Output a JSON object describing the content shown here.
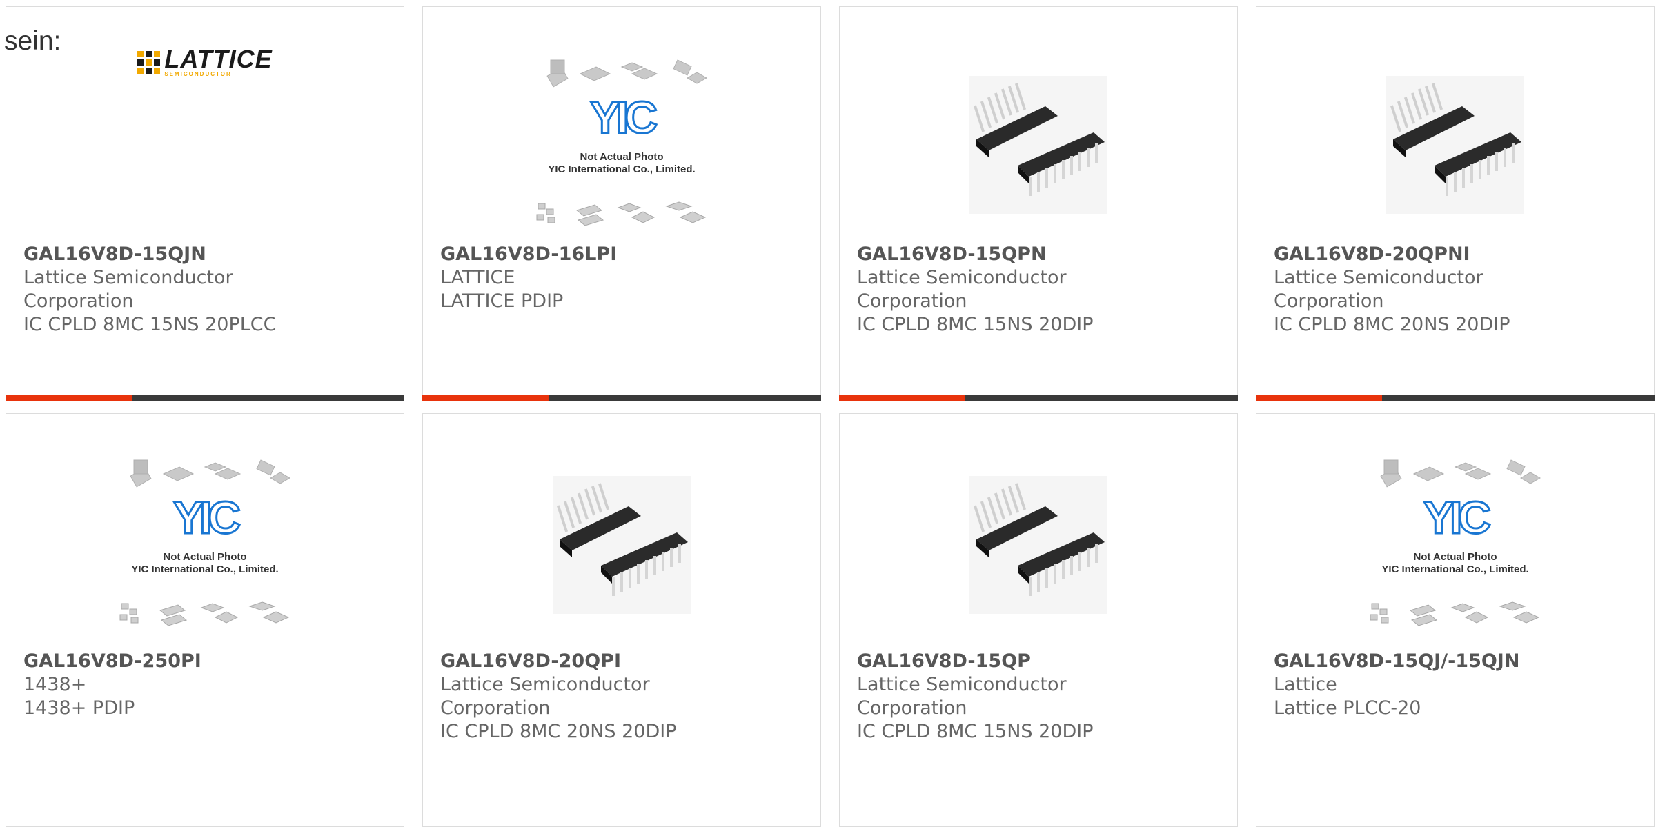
{
  "intro_text": "sein:",
  "icons": {
    "lattice": "lattice-logo-icon",
    "yic": "yic-placeholder-icon",
    "dip": "dip-chip-icon"
  },
  "colors": {
    "accent": "#e8330c",
    "bar": "#3a3a3a",
    "text": "#666666",
    "yic_blue": "#1976d2",
    "lattice_gold": "#f2a900"
  },
  "lattice_logo": {
    "word": "LATTICE",
    "sub": "SEMICONDUCTOR"
  },
  "yic_placeholder": {
    "logo": "YIC",
    "line1": "Not Actual Photo",
    "line2": "YIC International Co., Limited."
  },
  "products": [
    {
      "part": "GAL16V8D-15QJN",
      "mfr_line1": "Lattice Semiconductor",
      "mfr_line2": "Corporation",
      "desc": "IC CPLD 8MC 15NS 20PLCC",
      "image": "lattice-logo-icon"
    },
    {
      "part": "GAL16V8D-16LPI",
      "mfr_line1": "LATTICE",
      "mfr_line2": "",
      "desc": "LATTICE PDIP",
      "image": "yic-placeholder-icon"
    },
    {
      "part": "GAL16V8D-15QPN",
      "mfr_line1": "Lattice Semiconductor",
      "mfr_line2": "Corporation",
      "desc": "IC CPLD 8MC 15NS 20DIP",
      "image": "dip-chip-icon"
    },
    {
      "part": "GAL16V8D-20QPNI",
      "mfr_line1": "Lattice Semiconductor",
      "mfr_line2": "Corporation",
      "desc": "IC CPLD 8MC 20NS 20DIP",
      "image": "dip-chip-icon"
    },
    {
      "part": "GAL16V8D-250PI",
      "mfr_line1": "1438+",
      "mfr_line2": "",
      "desc": "1438+ PDIP",
      "image": "yic-placeholder-icon"
    },
    {
      "part": "GAL16V8D-20QPI",
      "mfr_line1": "Lattice Semiconductor",
      "mfr_line2": "Corporation",
      "desc": "IC CPLD 8MC 20NS 20DIP",
      "image": "dip-chip-icon"
    },
    {
      "part": "GAL16V8D-15QP",
      "mfr_line1": "Lattice Semiconductor",
      "mfr_line2": "Corporation",
      "desc": "IC CPLD 8MC 15NS 20DIP",
      "image": "dip-chip-icon"
    },
    {
      "part": "GAL16V8D-15QJ/-15QJN",
      "mfr_line1": "Lattice",
      "mfr_line2": "",
      "desc": "Lattice PLCC-20",
      "image": "yic-placeholder-icon"
    }
  ]
}
